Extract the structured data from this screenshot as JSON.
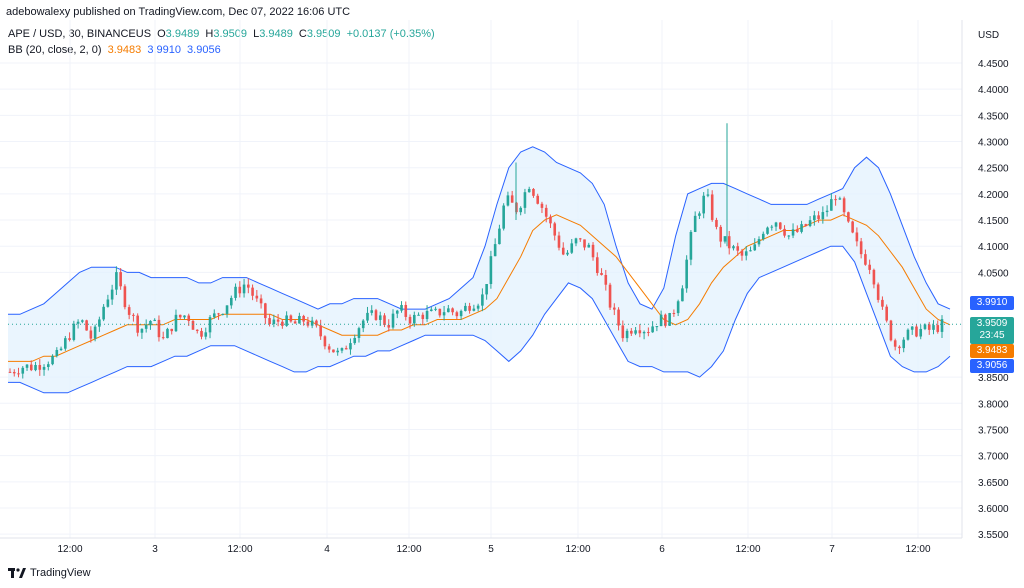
{
  "publisher": "adebowalexy published on TradingView.com, Dec 07, 2022 16:06 UTC",
  "legend": {
    "symbol": "APE / USD, 30, BINANCEUS",
    "o_label": "O",
    "o_value": "3.9489",
    "h_label": "H",
    "h_value": "3.9509",
    "l_label": "L",
    "l_value": "3.9489",
    "c_label": "C",
    "c_value": "3.9509",
    "change": "+0.0137 (+0.35%)",
    "bb_label": "BB (20, close, 2, 0)",
    "bb_basis": "3.9483",
    "bb_upper": "3.9910",
    "bb_lower": "3.9056"
  },
  "colors": {
    "up": "#26a69a",
    "down": "#ef5350",
    "basis": "#f57c00",
    "band": "#2962ff",
    "band_fill": "#e3f2fd"
  },
  "price_tags": {
    "upper": "3.9910",
    "last": "3.9509",
    "countdown": "23:45",
    "basis": "3.9483",
    "lower": "3.9056"
  },
  "footer": {
    "brand": "TradingView"
  },
  "chart_data": {
    "type": "candlestick",
    "currency_label": "USD",
    "y_ticks": [
      "4.4500",
      "4.4000",
      "4.3500",
      "4.3000",
      "4.2500",
      "4.2000",
      "4.1500",
      "4.1000",
      "4.0500",
      "3.8500",
      "3.8000",
      "3.7500",
      "3.7000",
      "3.6500",
      "3.6000",
      "3.5500"
    ],
    "ylim": [
      3.55,
      4.5
    ],
    "x_ticks": [
      "12:00",
      "3",
      "12:00",
      "4",
      "12:00",
      "5",
      "12:00",
      "6",
      "12:00",
      "7",
      "12:00"
    ],
    "last_price": 3.9509,
    "series": [
      {
        "name": "price",
        "values": [
          3.86,
          3.87,
          3.87,
          3.88,
          3.89,
          3.93,
          3.96,
          3.92,
          3.99,
          4.04,
          3.98,
          3.94,
          3.96,
          3.92,
          3.96,
          3.97,
          3.93,
          3.96,
          3.98,
          4.01,
          4.03,
          3.99,
          3.95,
          3.96,
          3.95,
          3.96,
          3.94,
          3.91,
          3.89,
          3.93,
          3.96,
          3.97,
          3.95,
          3.98,
          3.96,
          3.97,
          3.97,
          3.98,
          3.97,
          3.99,
          4.0,
          4.09,
          4.19,
          4.17,
          4.22,
          4.18,
          4.13,
          4.08,
          4.11,
          4.1,
          4.05,
          3.98,
          3.93,
          3.95,
          3.94,
          3.96,
          3.96,
          4.03,
          4.15,
          4.2,
          4.12,
          4.1,
          4.08,
          4.09,
          4.14,
          4.15,
          4.12,
          4.13,
          4.15,
          4.16,
          4.2,
          4.14,
          4.09,
          4.06,
          3.97,
          3.91,
          3.93,
          3.94,
          3.94,
          3.95
        ]
      },
      {
        "name": "basis",
        "values": [
          3.88,
          3.88,
          3.88,
          3.89,
          3.89,
          3.9,
          3.91,
          3.92,
          3.93,
          3.94,
          3.95,
          3.95,
          3.95,
          3.95,
          3.96,
          3.96,
          3.96,
          3.96,
          3.97,
          3.97,
          3.97,
          3.97,
          3.97,
          3.96,
          3.96,
          3.96,
          3.95,
          3.94,
          3.93,
          3.93,
          3.93,
          3.93,
          3.94,
          3.94,
          3.95,
          3.95,
          3.96,
          3.96,
          3.96,
          3.97,
          3.98,
          4.0,
          4.04,
          4.08,
          4.13,
          4.15,
          4.16,
          4.15,
          4.14,
          4.12,
          4.1,
          4.08,
          4.05,
          4.02,
          3.99,
          3.96,
          3.95,
          3.96,
          3.99,
          4.03,
          4.06,
          4.08,
          4.1,
          4.11,
          4.12,
          4.13,
          4.13,
          4.14,
          4.15,
          4.15,
          4.16,
          4.15,
          4.14,
          4.12,
          4.09,
          4.06,
          4.02,
          3.98,
          3.96,
          3.95
        ]
      },
      {
        "name": "upper",
        "values": [
          3.97,
          3.97,
          3.98,
          3.99,
          4.01,
          4.03,
          4.05,
          4.06,
          4.06,
          4.06,
          4.05,
          4.05,
          4.04,
          4.04,
          4.04,
          4.04,
          4.03,
          4.03,
          4.04,
          4.04,
          4.04,
          4.03,
          4.02,
          4.01,
          4.0,
          3.99,
          3.98,
          3.99,
          3.99,
          4.0,
          4.0,
          4.0,
          3.99,
          3.98,
          3.98,
          3.98,
          3.99,
          4.0,
          4.02,
          4.04,
          4.1,
          4.18,
          4.25,
          4.28,
          4.29,
          4.28,
          4.26,
          4.25,
          4.24,
          4.22,
          4.18,
          4.1,
          4.03,
          3.99,
          3.98,
          4.02,
          4.12,
          4.2,
          4.21,
          4.22,
          4.22,
          4.21,
          4.2,
          4.19,
          4.18,
          4.18,
          4.18,
          4.18,
          4.19,
          4.2,
          4.21,
          4.25,
          4.27,
          4.25,
          4.2,
          4.14,
          4.08,
          4.03,
          3.99,
          3.98
        ]
      },
      {
        "name": "lower",
        "values": [
          3.84,
          3.84,
          3.83,
          3.82,
          3.82,
          3.82,
          3.83,
          3.84,
          3.85,
          3.86,
          3.87,
          3.87,
          3.87,
          3.88,
          3.89,
          3.89,
          3.9,
          3.91,
          3.91,
          3.91,
          3.9,
          3.89,
          3.88,
          3.87,
          3.86,
          3.86,
          3.87,
          3.87,
          3.88,
          3.89,
          3.89,
          3.9,
          3.9,
          3.91,
          3.92,
          3.93,
          3.93,
          3.93,
          3.93,
          3.93,
          3.92,
          3.9,
          3.88,
          3.9,
          3.93,
          3.97,
          4.0,
          4.03,
          4.02,
          4.0,
          3.96,
          3.92,
          3.88,
          3.87,
          3.87,
          3.86,
          3.86,
          3.86,
          3.85,
          3.87,
          3.9,
          3.96,
          4.01,
          4.04,
          4.05,
          4.06,
          4.07,
          4.08,
          4.09,
          4.1,
          4.1,
          4.07,
          4.01,
          3.95,
          3.89,
          3.87,
          3.86,
          3.86,
          3.87,
          3.89
        ]
      }
    ]
  }
}
